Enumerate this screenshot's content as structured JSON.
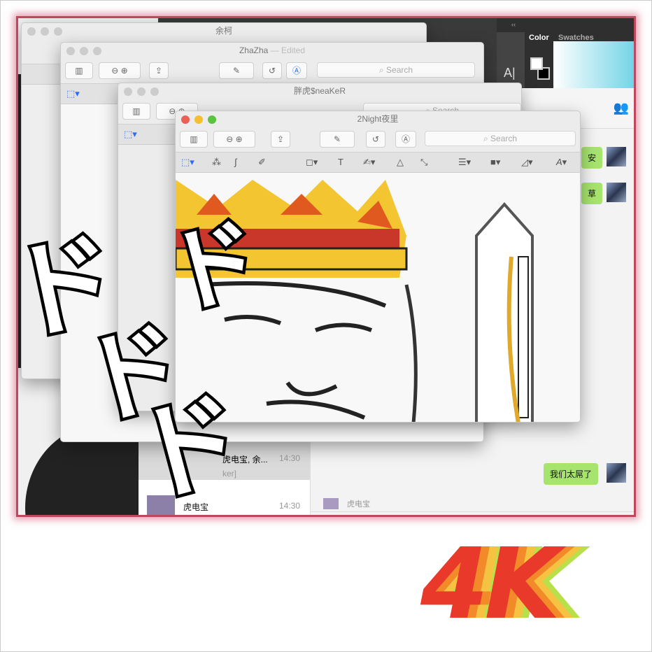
{
  "photoshop": {
    "collapse": "‹‹",
    "tabs": [
      "Color",
      "Swatches"
    ],
    "tool_text": "A|"
  },
  "windows": [
    {
      "title": "余柯"
    },
    {
      "title": "ZhaZha",
      "edited": "— Edited",
      "search": "Search"
    },
    {
      "title": "胖虎$neaKeR",
      "search": "Search"
    },
    {
      "title": "2Night夜里",
      "search": "Search"
    }
  ],
  "wechat": {
    "messages": [
      {
        "text": "安"
      },
      {
        "text": "草"
      },
      {
        "text": "我们太屌了"
      }
    ],
    "sender_preview": "虎电宝",
    "chats": [
      {
        "name": "虎电宝, 余...",
        "time": "14:30",
        "preview": "ker]"
      },
      {
        "name": "虎电宝",
        "time": "14:30"
      }
    ]
  },
  "overlay": {
    "text": "ドドドド",
    "badge": "4K"
  },
  "colors": {
    "frame": "#c0485e",
    "bubble": "#a7e46d",
    "traffic_red": "#ec5f57",
    "traffic_yellow": "#f5bf2f",
    "traffic_green": "#5ac43e"
  }
}
